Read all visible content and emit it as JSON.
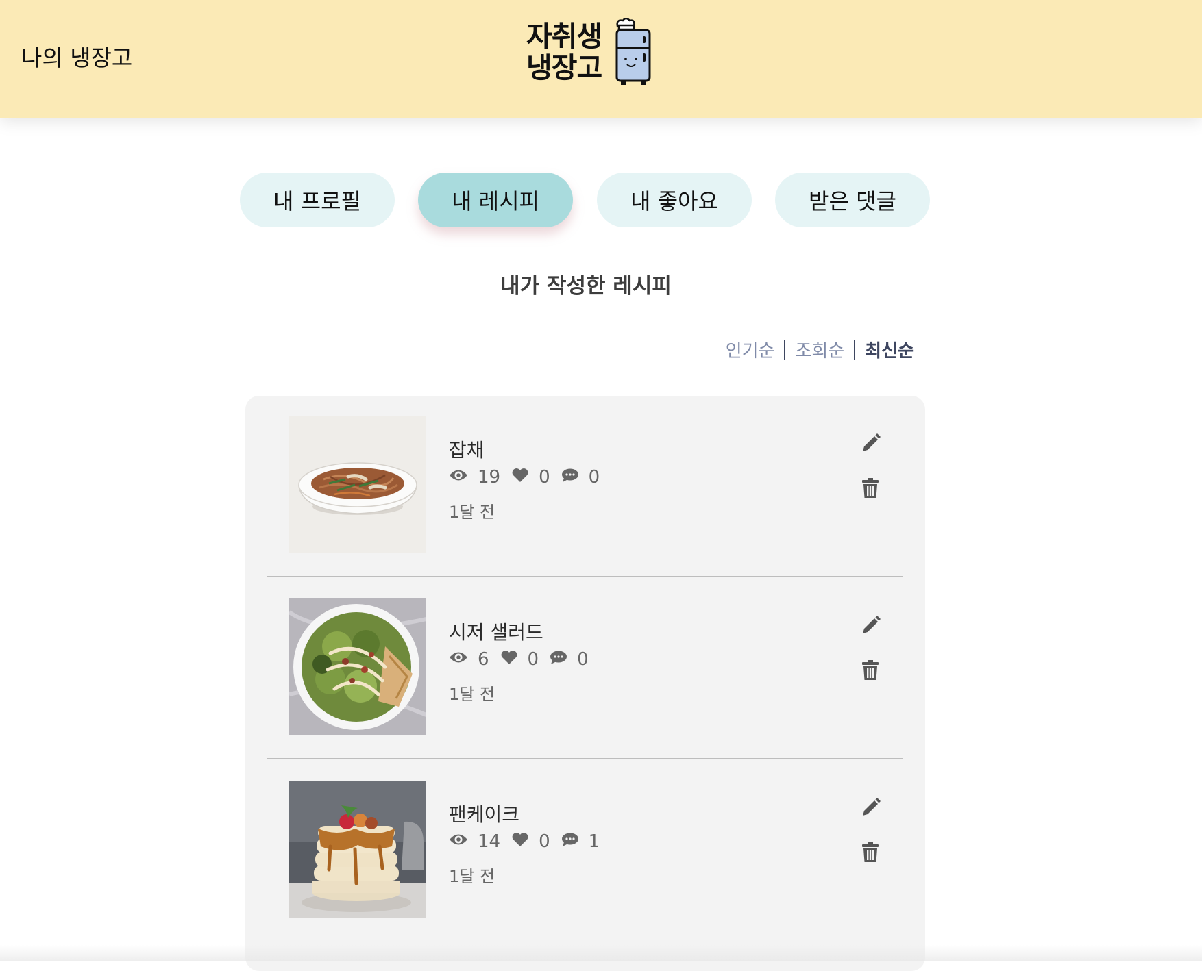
{
  "header": {
    "title": "나의 냉장고",
    "logo_line1": "자취생",
    "logo_line2": "냉장고"
  },
  "tabs": [
    {
      "label": "내 프로필",
      "active": false
    },
    {
      "label": "내 레시피",
      "active": true
    },
    {
      "label": "내 좋아요",
      "active": false
    },
    {
      "label": "받은 댓글",
      "active": false
    }
  ],
  "section_title": "내가 작성한 레시피",
  "sort": {
    "popular": "인기순",
    "views": "조회순",
    "latest": "최신순",
    "active": "latest"
  },
  "recipes": [
    {
      "name": "잡채",
      "views": "19",
      "likes": "0",
      "comments": "0",
      "date": "1달 전"
    },
    {
      "name": "시저 샐러드",
      "views": "6",
      "likes": "0",
      "comments": "0",
      "date": "1달 전"
    },
    {
      "name": "팬케이크",
      "views": "14",
      "likes": "0",
      "comments": "1",
      "date": "1달 전"
    }
  ],
  "icons": {
    "views": "eye-icon",
    "likes": "heart-icon",
    "comments": "comment-icon",
    "edit": "pencil-icon",
    "delete": "trash-icon",
    "logo": "fridge-chef-icon"
  },
  "colors": {
    "header_bg": "#fbeab6",
    "tab_bg": "#e5f4f5",
    "tab_active_bg": "#a9dbdd",
    "panel_bg": "#f3f3f3",
    "sort_inactive": "#7f8aa8",
    "sort_active": "#3e4660"
  }
}
